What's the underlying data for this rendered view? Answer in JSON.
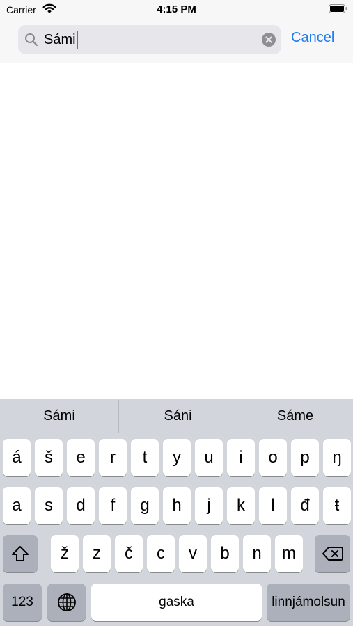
{
  "status": {
    "carrier": "Carrier",
    "time": "4:15 PM"
  },
  "search": {
    "value": "Sámi",
    "cancel_label": "Cancel"
  },
  "keyboard": {
    "suggestions": [
      "Sámi",
      "Sáni",
      "Sáme"
    ],
    "row1": [
      "á",
      "š",
      "e",
      "r",
      "t",
      "y",
      "u",
      "i",
      "o",
      "p",
      "ŋ"
    ],
    "row2": [
      "a",
      "s",
      "d",
      "f",
      "g",
      "h",
      "j",
      "k",
      "l",
      "đ",
      "ŧ"
    ],
    "row3": [
      "ž",
      "z",
      "č",
      "c",
      "v",
      "b",
      "n",
      "m"
    ],
    "numbers_label": "123",
    "space_label": "gaska",
    "return_label": "linnjámolsun"
  },
  "colors": {
    "accent": "#1f7cf2",
    "keyboard_bg": "#d2d5db",
    "dark_key": "#abb0ba"
  },
  "icons": {
    "search": "magnifying-glass",
    "clear": "x-circle",
    "shift": "shift-arrow",
    "delete": "delete-backspace",
    "globe": "globe"
  }
}
